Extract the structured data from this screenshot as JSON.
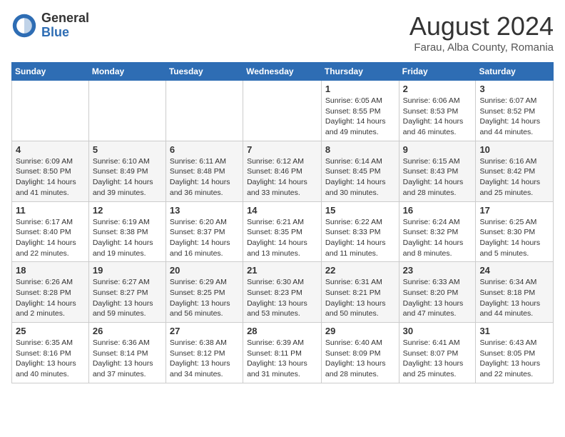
{
  "header": {
    "logo_general": "General",
    "logo_blue": "Blue",
    "main_title": "August 2024",
    "subtitle": "Farau, Alba County, Romania"
  },
  "weekdays": [
    "Sunday",
    "Monday",
    "Tuesday",
    "Wednesday",
    "Thursday",
    "Friday",
    "Saturday"
  ],
  "weeks": [
    [
      {
        "day": "",
        "info": ""
      },
      {
        "day": "",
        "info": ""
      },
      {
        "day": "",
        "info": ""
      },
      {
        "day": "",
        "info": ""
      },
      {
        "day": "1",
        "info": "Sunrise: 6:05 AM\nSunset: 8:55 PM\nDaylight: 14 hours and 49 minutes."
      },
      {
        "day": "2",
        "info": "Sunrise: 6:06 AM\nSunset: 8:53 PM\nDaylight: 14 hours and 46 minutes."
      },
      {
        "day": "3",
        "info": "Sunrise: 6:07 AM\nSunset: 8:52 PM\nDaylight: 14 hours and 44 minutes."
      }
    ],
    [
      {
        "day": "4",
        "info": "Sunrise: 6:09 AM\nSunset: 8:50 PM\nDaylight: 14 hours and 41 minutes."
      },
      {
        "day": "5",
        "info": "Sunrise: 6:10 AM\nSunset: 8:49 PM\nDaylight: 14 hours and 39 minutes."
      },
      {
        "day": "6",
        "info": "Sunrise: 6:11 AM\nSunset: 8:48 PM\nDaylight: 14 hours and 36 minutes."
      },
      {
        "day": "7",
        "info": "Sunrise: 6:12 AM\nSunset: 8:46 PM\nDaylight: 14 hours and 33 minutes."
      },
      {
        "day": "8",
        "info": "Sunrise: 6:14 AM\nSunset: 8:45 PM\nDaylight: 14 hours and 30 minutes."
      },
      {
        "day": "9",
        "info": "Sunrise: 6:15 AM\nSunset: 8:43 PM\nDaylight: 14 hours and 28 minutes."
      },
      {
        "day": "10",
        "info": "Sunrise: 6:16 AM\nSunset: 8:42 PM\nDaylight: 14 hours and 25 minutes."
      }
    ],
    [
      {
        "day": "11",
        "info": "Sunrise: 6:17 AM\nSunset: 8:40 PM\nDaylight: 14 hours and 22 minutes."
      },
      {
        "day": "12",
        "info": "Sunrise: 6:19 AM\nSunset: 8:38 PM\nDaylight: 14 hours and 19 minutes."
      },
      {
        "day": "13",
        "info": "Sunrise: 6:20 AM\nSunset: 8:37 PM\nDaylight: 14 hours and 16 minutes."
      },
      {
        "day": "14",
        "info": "Sunrise: 6:21 AM\nSunset: 8:35 PM\nDaylight: 14 hours and 13 minutes."
      },
      {
        "day": "15",
        "info": "Sunrise: 6:22 AM\nSunset: 8:33 PM\nDaylight: 14 hours and 11 minutes."
      },
      {
        "day": "16",
        "info": "Sunrise: 6:24 AM\nSunset: 8:32 PM\nDaylight: 14 hours and 8 minutes."
      },
      {
        "day": "17",
        "info": "Sunrise: 6:25 AM\nSunset: 8:30 PM\nDaylight: 14 hours and 5 minutes."
      }
    ],
    [
      {
        "day": "18",
        "info": "Sunrise: 6:26 AM\nSunset: 8:28 PM\nDaylight: 14 hours and 2 minutes."
      },
      {
        "day": "19",
        "info": "Sunrise: 6:27 AM\nSunset: 8:27 PM\nDaylight: 13 hours and 59 minutes."
      },
      {
        "day": "20",
        "info": "Sunrise: 6:29 AM\nSunset: 8:25 PM\nDaylight: 13 hours and 56 minutes."
      },
      {
        "day": "21",
        "info": "Sunrise: 6:30 AM\nSunset: 8:23 PM\nDaylight: 13 hours and 53 minutes."
      },
      {
        "day": "22",
        "info": "Sunrise: 6:31 AM\nSunset: 8:21 PM\nDaylight: 13 hours and 50 minutes."
      },
      {
        "day": "23",
        "info": "Sunrise: 6:33 AM\nSunset: 8:20 PM\nDaylight: 13 hours and 47 minutes."
      },
      {
        "day": "24",
        "info": "Sunrise: 6:34 AM\nSunset: 8:18 PM\nDaylight: 13 hours and 44 minutes."
      }
    ],
    [
      {
        "day": "25",
        "info": "Sunrise: 6:35 AM\nSunset: 8:16 PM\nDaylight: 13 hours and 40 minutes."
      },
      {
        "day": "26",
        "info": "Sunrise: 6:36 AM\nSunset: 8:14 PM\nDaylight: 13 hours and 37 minutes."
      },
      {
        "day": "27",
        "info": "Sunrise: 6:38 AM\nSunset: 8:12 PM\nDaylight: 13 hours and 34 minutes."
      },
      {
        "day": "28",
        "info": "Sunrise: 6:39 AM\nSunset: 8:11 PM\nDaylight: 13 hours and 31 minutes."
      },
      {
        "day": "29",
        "info": "Sunrise: 6:40 AM\nSunset: 8:09 PM\nDaylight: 13 hours and 28 minutes."
      },
      {
        "day": "30",
        "info": "Sunrise: 6:41 AM\nSunset: 8:07 PM\nDaylight: 13 hours and 25 minutes."
      },
      {
        "day": "31",
        "info": "Sunrise: 6:43 AM\nSunset: 8:05 PM\nDaylight: 13 hours and 22 minutes."
      }
    ]
  ]
}
